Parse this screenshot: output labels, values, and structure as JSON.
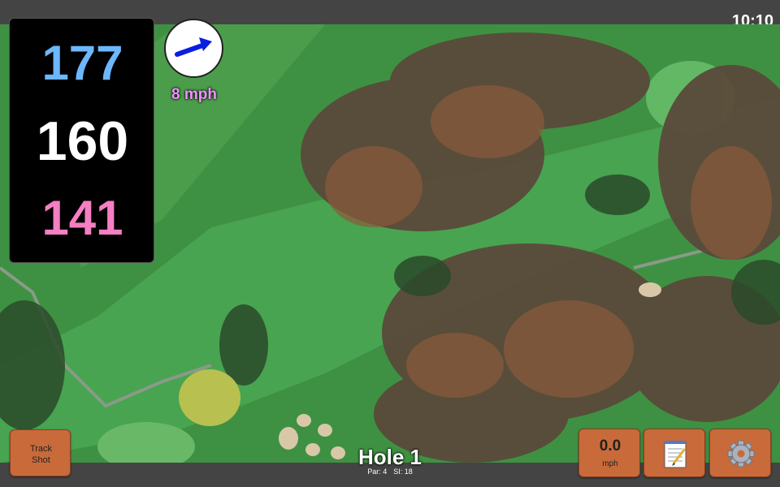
{
  "status_bar": {
    "time": "10:10"
  },
  "distances": {
    "back": "177",
    "middle": "160",
    "front": "141"
  },
  "wind": {
    "speed_label": "8 mph",
    "direction_icon": "arrow-right-up-icon"
  },
  "track_shot": {
    "line1": "Track",
    "line2": "Shot"
  },
  "hole": {
    "title": "Hole 1",
    "par": "Par: 4",
    "si": "SI: 18"
  },
  "speed": {
    "value": "0.0",
    "unit": "mph"
  },
  "icons": {
    "notes": "notepad-icon",
    "settings": "gear-icon"
  },
  "colors": {
    "back_distance": "#6db7ff",
    "middle_distance": "#ffffff",
    "front_distance": "#f57fc2",
    "wind_label": "#f092ff",
    "button": "#c96a3a",
    "bar": "#444444"
  }
}
